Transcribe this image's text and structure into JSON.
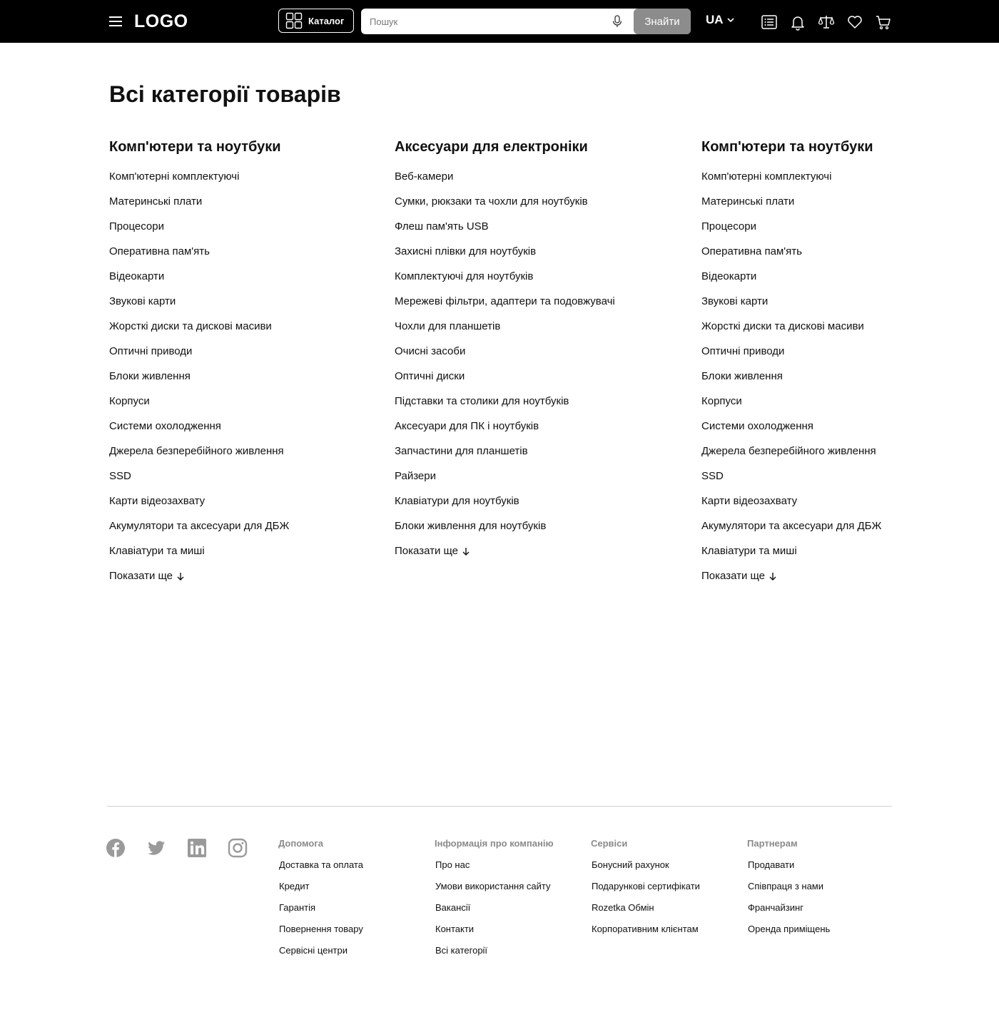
{
  "header": {
    "logo": "LOGO",
    "catalog_label": "Каталог",
    "search_placeholder": "Пошук",
    "search_button": "Знайти",
    "language": "UA"
  },
  "page_title": "Всі категорії товарів",
  "columns": [
    {
      "title": "Комп'ютери та ноутбуки",
      "items": [
        "Комп'ютерні комплектуючі",
        "Материнські плати",
        "Процесори",
        "Оперативна пам'ять",
        "Відеокарти",
        "Звукові карти",
        "Жорсткі диски та дискові масиви",
        "Оптичні приводи",
        "Блоки живлення",
        "Корпуси",
        "Системи охолодження",
        "Джерела безперебійного живлення",
        "SSD",
        "Карти відеозахвату",
        "Акумулятори та аксесуари для ДБЖ",
        "Клавіатури та миші"
      ],
      "more": "Показати ще"
    },
    {
      "title": "Аксесуари для електроніки",
      "items": [
        "Веб-камери",
        "Сумки, рюкзаки та чохли для ноутбуків",
        "Флеш пам'ять USB",
        "Захисні плівки для ноутбуків",
        "Комплектуючі для ноутбуків",
        "Мережеві фільтри, адаптери та подовжувачі",
        "Чохли для планшетів",
        "Очисні засоби",
        "Оптичні диски",
        "Підставки та столики для ноутбуків",
        "Аксесуари для ПК і ноутбуків",
        "Запчастини для планшетів",
        "Райзери",
        "Клавіатури для ноутбуків",
        "Блоки живлення для ноутбуків"
      ],
      "more": "Показати ще"
    },
    {
      "title": "Комп'ютери та ноутбуки",
      "items": [
        "Комп'ютерні комплектуючі",
        "Материнські плати",
        "Процесори",
        "Оперативна пам'ять",
        "Відеокарти",
        "Звукові карти",
        "Жорсткі диски та дискові масиви",
        "Оптичні приводи",
        "Блоки живлення",
        "Корпуси",
        "Системи охолодження",
        "Джерела безперебійного живлення",
        "SSD",
        "Карти відеозахвату",
        "Акумулятори та аксесуари для ДБЖ",
        "Клавіатури та миші"
      ],
      "more": "Показати ще"
    }
  ],
  "footer": {
    "social_icons": [
      "facebook-icon",
      "twitter-icon",
      "linkedin-icon",
      "instagram-icon"
    ],
    "columns": [
      {
        "title": "Допомога",
        "items": [
          "Доставка та оплата",
          "Кредит",
          "Гарантія",
          "Повернення товару",
          "Сервісні центри"
        ]
      },
      {
        "title": "Інформація про компанію",
        "items": [
          "Про нас",
          "Умови використання сайту",
          "Вакансії",
          "Контакти",
          "Всі категорії"
        ]
      },
      {
        "title": "Сервіси",
        "items": [
          "Бонусний рахунок",
          "Подарункові сертифікати",
          "Rozetka Обмін",
          "Корпоративним клієнтам"
        ]
      },
      {
        "title": "Партнерам",
        "items": [
          "Продавати",
          "Співпраця з нами",
          "Франчайзинг",
          "Оренда приміщень"
        ]
      }
    ]
  },
  "colors": {
    "header_bg": "#000000",
    "search_button_bg": "#8c8c8c",
    "footer_heading": "#8a8a8a",
    "social_icon": "#9a9a9a"
  }
}
